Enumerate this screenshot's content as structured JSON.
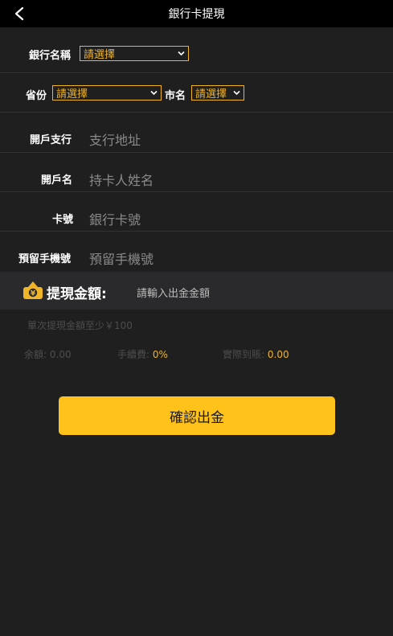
{
  "header": {
    "title": "銀行卡提現"
  },
  "form": {
    "bank_name_label": "銀行名稱",
    "bank_name_select": "請選擇",
    "province_label": "省份",
    "province_select": "請選擇",
    "city_label": "市名",
    "city_select": "請選擇",
    "branch_label": "開戶支行",
    "branch_placeholder": "支行地址",
    "holder_label": "開戶名",
    "holder_placeholder": "持卡人姓名",
    "card_label": "卡號",
    "card_placeholder": "銀行卡號",
    "phone_label": "預留手機號",
    "phone_placeholder": "預留手機號"
  },
  "amount": {
    "label": "提現金額:",
    "placeholder": "請輸入出金金額",
    "hint": "單次提現金額至少￥100"
  },
  "stats": {
    "balance_label": "余額:",
    "balance_value": "0.00",
    "fee_label": "手續費:",
    "fee_value": "0%",
    "actual_label": "實際到賬:",
    "actual_value": "0.00"
  },
  "confirm_button": "確認出金",
  "colors": {
    "accent": "#ffc21a",
    "select_border": "#f0b429",
    "background": "#1f1f1f",
    "header": "#000000"
  }
}
